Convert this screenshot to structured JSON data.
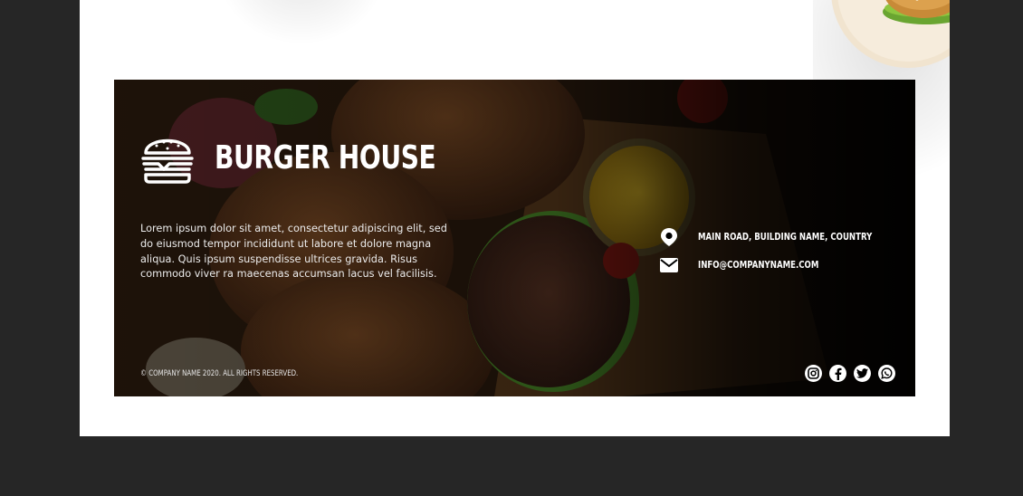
{
  "footer": {
    "brand": "BURGER HOUSE",
    "description": "Lorem ipsum dolor sit amet, consectetur adipiscing elit, sed do eiusmod tempor incididunt ut labore et dolore magna aliqua. Quis ipsum suspendisse ultrices gravida. Risus commodo viver ra maecenas accumsan lacus vel facilisis.",
    "address": "MAIN ROAD, BUILDING NAME, COUNTRY",
    "email": "INFO@COMPANYNAME.COM",
    "copyright": "© COMPANY NAME 2020. ALL RIGHTS RESERVED.",
    "social_icons": [
      "instagram-icon",
      "facebook-icon",
      "twitter-icon",
      "whatsapp-icon"
    ]
  },
  "colors": {
    "page_background": "#262626",
    "card_background": "#ffffff",
    "footer_overlay": "#000000",
    "text": "#ffffff"
  }
}
